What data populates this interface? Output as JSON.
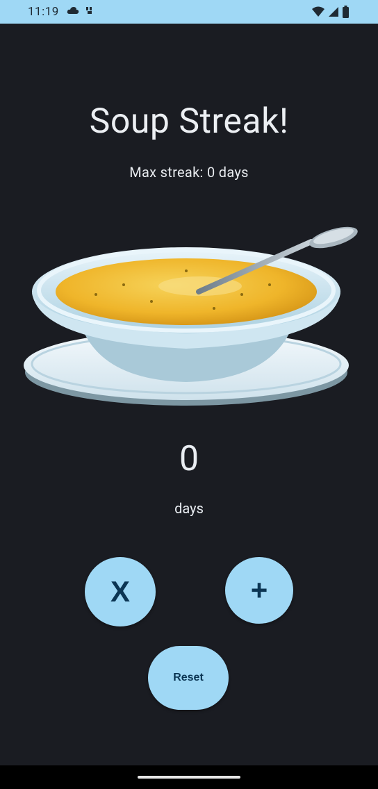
{
  "status_bar": {
    "time": "11:19",
    "icons_left": [
      "cloud-icon",
      "signal-icon"
    ],
    "icons_right": [
      "wifi-icon",
      "cell-signal-icon",
      "battery-icon"
    ],
    "background": "#9fd8f5"
  },
  "app": {
    "title": "Soup Streak!",
    "max_streak_text": "Max streak: 0 days",
    "image": "soup-bowl-image",
    "count": "0",
    "unit": "days",
    "background": "#1a1c22",
    "accent": "#9fd8f5"
  },
  "buttons": {
    "x_label": "X",
    "plus_label": "+",
    "reset_label": "Reset"
  }
}
